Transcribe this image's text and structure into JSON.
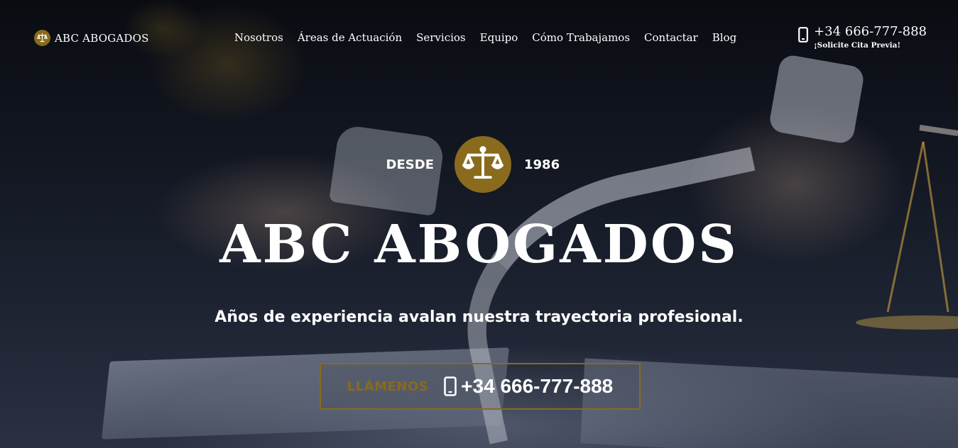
{
  "brand": {
    "name": "ABC ABOGADOS",
    "accent_color": "#8a6a1c",
    "logo_icon": "scales-of-justice-icon"
  },
  "nav": {
    "items": [
      {
        "label": "Nosotros"
      },
      {
        "label": "Áreas de Actuación"
      },
      {
        "label": "Servicios"
      },
      {
        "label": "Equipo"
      },
      {
        "label": "Cómo Trabajamos"
      },
      {
        "label": "Contactar"
      },
      {
        "label": "Blog"
      }
    ]
  },
  "header_contact": {
    "icon": "mobile-phone-icon",
    "phone": "+34 666-777-888",
    "subtitle": "¡Solicite Cita Previa!"
  },
  "hero": {
    "since_label": "DESDE",
    "since_year": "1986",
    "badge_icon": "scales-of-justice-icon",
    "title": "ABC ABOGADOS",
    "subtitle": "Años de experiencia avalan nuestra trayectoria profesional."
  },
  "cta": {
    "label": "LLÁMENOS",
    "icon": "mobile-phone-icon",
    "phone": "+34 666-777-888"
  }
}
